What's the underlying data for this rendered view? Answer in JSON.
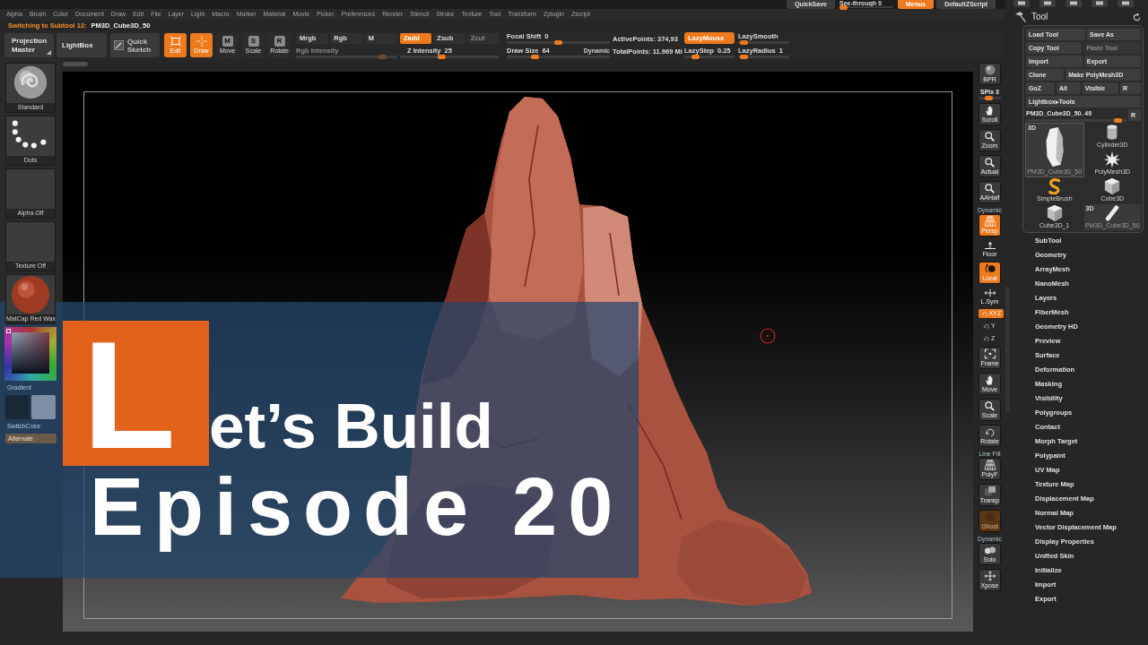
{
  "top_bar": {
    "quick_save": "QuickSave",
    "see_through": {
      "label": "See-through",
      "value": "0",
      "level": 0
    },
    "menus": {
      "label": "Menus",
      "on": true
    },
    "script": "DefaultZScript"
  },
  "menu_bar": {
    "items": [
      "Alpha",
      "Brush",
      "Color",
      "Document",
      "Draw",
      "Edit",
      "File",
      "Layer",
      "Light",
      "Macro",
      "Marker",
      "Material",
      "Movie",
      "Picker",
      "Preferences",
      "Render",
      "Stencil",
      "Stroke",
      "Texture",
      "Tool",
      "Transform",
      "Zplugin",
      "Zscript"
    ]
  },
  "notice": {
    "label": "Switching to Subtool 13:",
    "value": "PM3D_Cube3D_50"
  },
  "toolbar": {
    "projection_master": "Projection Master",
    "lightbox": "LightBox",
    "quick_sketch": "Quick Sketch",
    "transform_modes": [
      {
        "label": "Edit",
        "kind": "edit",
        "selected": true
      },
      {
        "label": "Draw",
        "kind": "draw",
        "selected": true
      },
      {
        "label": "Move",
        "kind": "glyph",
        "glyph": "M",
        "selected": false
      },
      {
        "label": "Scale",
        "kind": "glyph",
        "glyph": "S",
        "selected": false
      },
      {
        "label": "Rotate",
        "kind": "glyph",
        "glyph": "R",
        "selected": false
      }
    ],
    "color_modes": [
      {
        "label": "Mrgb",
        "selected": false
      },
      {
        "label": "Rgb",
        "selected": false
      },
      {
        "label": "M",
        "selected": false
      }
    ],
    "rgb_intensity": {
      "label": "Rgb Intensity",
      "disabled": true,
      "level": 0.88
    },
    "z_modes": [
      {
        "label": "Zadd",
        "selected": true,
        "disabled": false
      },
      {
        "label": "Zsub",
        "selected": false,
        "disabled": false
      },
      {
        "label": "Zcut",
        "selected": false,
        "disabled": true
      }
    ],
    "z_intensity": {
      "label": "Z Intensity",
      "value": "25",
      "level": 0.42
    },
    "focal_shift": {
      "label": "Focal Shift",
      "value": "0",
      "level": 0.5
    },
    "draw_size": {
      "label": "Draw Size",
      "value": "64",
      "level": 0.25
    },
    "dynamic": "Dynamic",
    "active_points": "ActivePoints: 374,93",
    "total_points": "TotalPoints: 11.969 Mi",
    "lazy_mouse": {
      "label": "LazyMouse",
      "on": true
    },
    "lazy_smooth": {
      "label": "LazySmooth",
      "level": 0.05
    },
    "lazy_step": {
      "label": "LazyStep",
      "value": "0.25",
      "level": 0.18
    },
    "lazy_radius": {
      "label": "LazyRadius",
      "value": "1",
      "level": 0.05
    }
  },
  "left_shelf": {
    "items": [
      {
        "kind": "brush",
        "label": "Standard"
      },
      {
        "kind": "stroke",
        "label": "Dots"
      },
      {
        "kind": "alpha",
        "label": "Alpha Off"
      },
      {
        "kind": "texture",
        "label": "Texture Off"
      },
      {
        "kind": "material",
        "label": "MatCap Red Wax"
      }
    ],
    "gradient": "Gradient",
    "swatches": [
      {
        "color": "#1b2838"
      },
      {
        "color": "#7d8ea5"
      }
    ],
    "switch_color": "SwitchColor",
    "alternate": "Alternate"
  },
  "title_card": {
    "initial": "L",
    "title": "et’s Build",
    "subtitle": "Episode 20"
  },
  "right_shelf": {
    "items": [
      {
        "kind": "tile",
        "label": "BPR",
        "selected": false,
        "disabled": false
      },
      {
        "kind": "slider",
        "label": "SPix 3",
        "level": 0.45
      },
      {
        "kind": "tile",
        "label": "Scroll",
        "selected": false,
        "disabled": false
      },
      {
        "kind": "tile",
        "label": "Zoom",
        "selected": false,
        "disabled": false
      },
      {
        "kind": "tile",
        "label": "Actual",
        "selected": false,
        "disabled": false
      },
      {
        "kind": "tile",
        "label": "AAHalf",
        "selected": false,
        "disabled": false
      },
      {
        "kind": "tile",
        "label": "Persp",
        "caption": "Dynamic",
        "selected": true,
        "disabled": false
      },
      {
        "kind": "flat",
        "label": "Floor",
        "selected": false,
        "disabled": false
      },
      {
        "kind": "tile",
        "label": "Local",
        "selected": true,
        "disabled": false
      },
      {
        "kind": "flat",
        "label": "L.Sym",
        "selected": false,
        "disabled": false
      },
      {
        "kind": "toggle",
        "label": "XYZ",
        "selected": true,
        "disabled": false
      },
      {
        "kind": "small",
        "label": "Y",
        "selected": false,
        "disabled": false
      },
      {
        "kind": "small",
        "label": "Z",
        "selected": false,
        "disabled": false
      },
      {
        "kind": "tile",
        "label": "Frame",
        "selected": false,
        "disabled": false
      },
      {
        "kind": "tile",
        "label": "Move",
        "selected": false,
        "disabled": false
      },
      {
        "kind": "tile",
        "label": "Scale",
        "selected": false,
        "disabled": false
      },
      {
        "kind": "tile",
        "label": "Rotate",
        "selected": false,
        "disabled": false
      },
      {
        "kind": "tile",
        "label": "PolyF",
        "caption": "Line Fill",
        "selected": false,
        "disabled": false
      },
      {
        "kind": "tile",
        "label": "Transp",
        "selected": false,
        "disabled": false
      },
      {
        "kind": "tile",
        "label": "Ghost",
        "selected": true,
        "disabled": true
      },
      {
        "kind": "tile",
        "label": "Solo",
        "caption": "Dynamic",
        "selected": false,
        "disabled": false
      },
      {
        "kind": "tile",
        "label": "Xpose",
        "selected": false,
        "disabled": false
      }
    ]
  },
  "tool_panel": {
    "title": "Tool",
    "button_rows": [
      [
        {
          "label": "Load Tool",
          "disabled": false
        },
        {
          "label": "Save As",
          "disabled": false
        }
      ],
      [
        {
          "label": "Copy Tool",
          "disabled": false
        },
        {
          "label": "Paste Tool",
          "disabled": true
        }
      ],
      [
        {
          "label": "Import",
          "disabled": false
        },
        {
          "label": "Export",
          "disabled": false
        }
      ],
      [
        {
          "label": "Clone",
          "disabled": false
        },
        {
          "label": "Make PolyMesh3D",
          "disabled": false
        }
      ],
      [
        {
          "label": "GoZ",
          "disabled": false
        },
        {
          "label": "All",
          "disabled": false
        },
        {
          "label": "Visible",
          "disabled": false
        },
        {
          "label": "R",
          "disabled": false
        }
      ],
      [
        {
          "label": "Lightbox▸Tools",
          "disabled": false
        }
      ]
    ],
    "current_tool": {
      "label": "PM3D_Cube3D_50. 49",
      "level": 0.95,
      "reset": "R"
    },
    "tools": [
      {
        "label": "PM3D_Cube3D_50",
        "kind": "mesh",
        "badge": "3D",
        "selected": true
      },
      {
        "label": "SimpleBrush",
        "kind": "brush",
        "selected": false
      },
      {
        "label": "Cube3D_1",
        "kind": "cube",
        "selected": false
      },
      {
        "label": "Cylinder3D",
        "kind": "cylinder",
        "selected": false
      },
      {
        "label": "PolyMesh3D",
        "kind": "star",
        "selected": false
      },
      {
        "label": "Cube3D",
        "kind": "cube",
        "selected": false
      },
      {
        "label": "PM3D_Cube3D_50",
        "kind": "stick",
        "badge": "3D",
        "selected": false
      }
    ],
    "menu": [
      "SubTool",
      "Geometry",
      "ArrayMesh",
      "NanoMesh",
      "Layers",
      "FiberMesh",
      "Geometry HD",
      "Preview",
      "Surface",
      "Deformation",
      "Masking",
      "Visibility",
      "Polygroups",
      "Contact",
      "Morph Target",
      "Polypaint",
      "UV Map",
      "Texture Map",
      "Displacement Map",
      "Normal Map",
      "Vector Displacement Map",
      "Display Properties",
      "Unified Skin",
      "Initialize",
      "Import",
      "Export"
    ]
  }
}
